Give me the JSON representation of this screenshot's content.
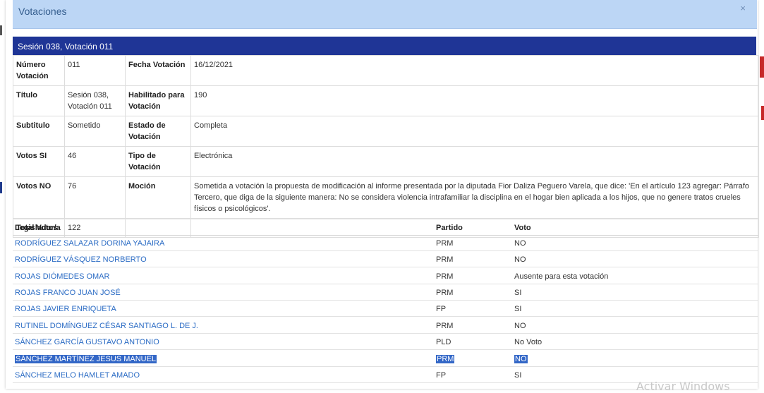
{
  "modal": {
    "title": "Votaciones",
    "close": "×"
  },
  "session_title": "Sesión 038, Votación 011",
  "details": {
    "numero_label": "Número Votación",
    "numero": "011",
    "fecha_label": "Fecha Votación",
    "fecha": "16/12/2021",
    "titulo_label": "Título",
    "titulo": "Sesión 038, Votación 011",
    "habilitado_label": "Habilitado para Votación",
    "habilitado": "190",
    "subtitulo_label": "Subtitulo",
    "subtitulo": "Sometido",
    "estado_label": "Estado de Votación",
    "estado": "Completa",
    "si_label": "Votos SI",
    "si": "46",
    "tipo_label": "Tipo de Votación",
    "tipo": "Electrónica",
    "no_label": "Votos NO",
    "no": "76",
    "mocion_label": "Moción",
    "mocion": "Sometida a votación la propuesta de modificación al informe presentada por la diputada Fior Daliza Peguero Varela, que dice: 'En el artículo 123 agregar: Párrafo Tercero, que diga de la siguiente manera: No se considera violencia intrafamiliar la disciplina en el hogar bien aplicada a los hijos, que no genere tratos crueles físicos o psicológicos'.",
    "total_label": "Total Votos",
    "total": "122"
  },
  "voters": {
    "headers": {
      "name": "Legislador/a",
      "party": "Partido",
      "vote": "Voto"
    },
    "rows": [
      {
        "name": "RODRÍGUEZ SALAZAR DORINA YAJAIRA",
        "party": "PRM",
        "vote": "NO"
      },
      {
        "name": "RODRÍGUEZ VÁSQUEZ NORBERTO",
        "party": "PRM",
        "vote": "NO"
      },
      {
        "name": "ROJAS DIÓMEDES OMAR",
        "party": "PRM",
        "vote": "Ausente para esta votación"
      },
      {
        "name": "ROJAS FRANCO JUAN JOSÉ",
        "party": "PRM",
        "vote": "SI"
      },
      {
        "name": "ROJAS JAVIER ENRIQUETA",
        "party": "FP",
        "vote": "SI"
      },
      {
        "name": "RUTINEL DOMÍNGUEZ CÉSAR SANTIAGO L. DE J.",
        "party": "PRM",
        "vote": "NO"
      },
      {
        "name": "SÁNCHEZ GARCÍA GUSTAVO ANTONIO",
        "party": "PLD",
        "vote": "No Voto"
      },
      {
        "name": "SÁNCHEZ MARTÍNEZ JESÚS MANUEL",
        "party": "PRM",
        "vote": "NO"
      },
      {
        "name": "SÁNCHEZ MELO HAMLET AMADO",
        "party": "FP",
        "vote": "SI"
      }
    ]
  },
  "watermark": "Activar Windows",
  "colors": {
    "header_bg": "#bcd6f5",
    "session_bar": "#1f3596",
    "link": "#2a6bc4",
    "selection": "#3367c7"
  }
}
